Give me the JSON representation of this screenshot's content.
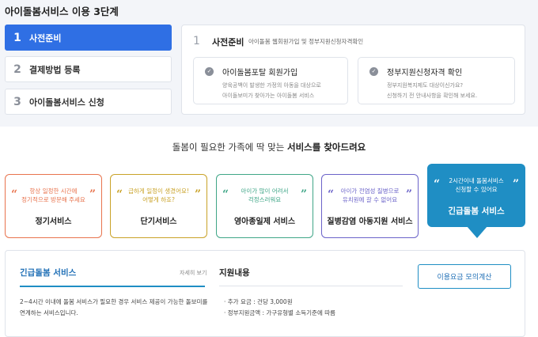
{
  "page_title": "아이돌봄서비스 이용 3단계",
  "steps": [
    {
      "num": "1",
      "label": "사전준비"
    },
    {
      "num": "2",
      "label": "결제방법 등록"
    },
    {
      "num": "3",
      "label": "아이돌봄서비스 신청"
    }
  ],
  "active_step": 1,
  "panel": {
    "num": "1",
    "title": "사전준비",
    "desc": "아이돌봄 웹회원가입 및 정부지원신청자격확인",
    "cards": [
      {
        "check": "✓",
        "title": "아이돌봄포탈 회원가입",
        "desc_line1": "양육공백이 발생한 가정의 아동을 대상으로",
        "desc_line2": "아이돌보미가 찾아가는 아이돌봄 서비스"
      },
      {
        "check": "✓",
        "title": "정부지원신청자격 확인",
        "desc_line1": "정부지원복지제도 대상이신가요?",
        "desc_line2": "신청하기 전 안내사항을 확인해 보세요."
      }
    ]
  },
  "headline": {
    "prefix": "돌봄이 필요한 가족에 딱 맞는 ",
    "emphasis": "서비스를 찾아드려요"
  },
  "quote_open": "“",
  "quote_close": "”",
  "services": [
    {
      "tag_line1": "항상 일정한 시간에",
      "tag_line2": "정기적으로 방문해 주세요",
      "name": "정기서비스",
      "color": "#e8734d"
    },
    {
      "tag_line1": "급하게 일정이 생겼어요!",
      "tag_line2": "어떻게 하죠?",
      "name": "단기서비스",
      "color": "#c9a227"
    },
    {
      "tag_line1": "아이가 많이 어려서",
      "tag_line2": "걱정스러워요",
      "name": "영아종일제 서비스",
      "color": "#3fa687"
    },
    {
      "tag_line1": "아이가 전염성 질병으로",
      "tag_line2": "유치원에 갈 수 없어요",
      "name": "질병감염 아동지원 서비스",
      "color": "#6b63c9"
    },
    {
      "tag_line1": "2시간이내 돌봄서비스",
      "tag_line2": "신청할 수 있어요",
      "name": "긴급돌봄 서비스",
      "color": "#1f8ec4"
    }
  ],
  "active_service": 5,
  "detail": {
    "title": "긴급돌봄 서비스",
    "more_link": "자세히 보기",
    "desc_line1": "2~4시간 이내에 돌봄 서비스가 필요한 경우 서비스 제공이 가능한 돌보미를",
    "desc_line2": "연계하는 서비스입니다.",
    "support_title": "지원내용",
    "support_items": [
      "· 추가 요금 : 건당 3,000원",
      "· 정부지원금액 : 가구유형별 소득기준에 따름"
    ],
    "calc_button": "이용요금 모의계산"
  },
  "colors": {
    "accent_blue": "#2f6fe4",
    "teal": "#1f8ec4",
    "background": "#f3f5f9"
  }
}
